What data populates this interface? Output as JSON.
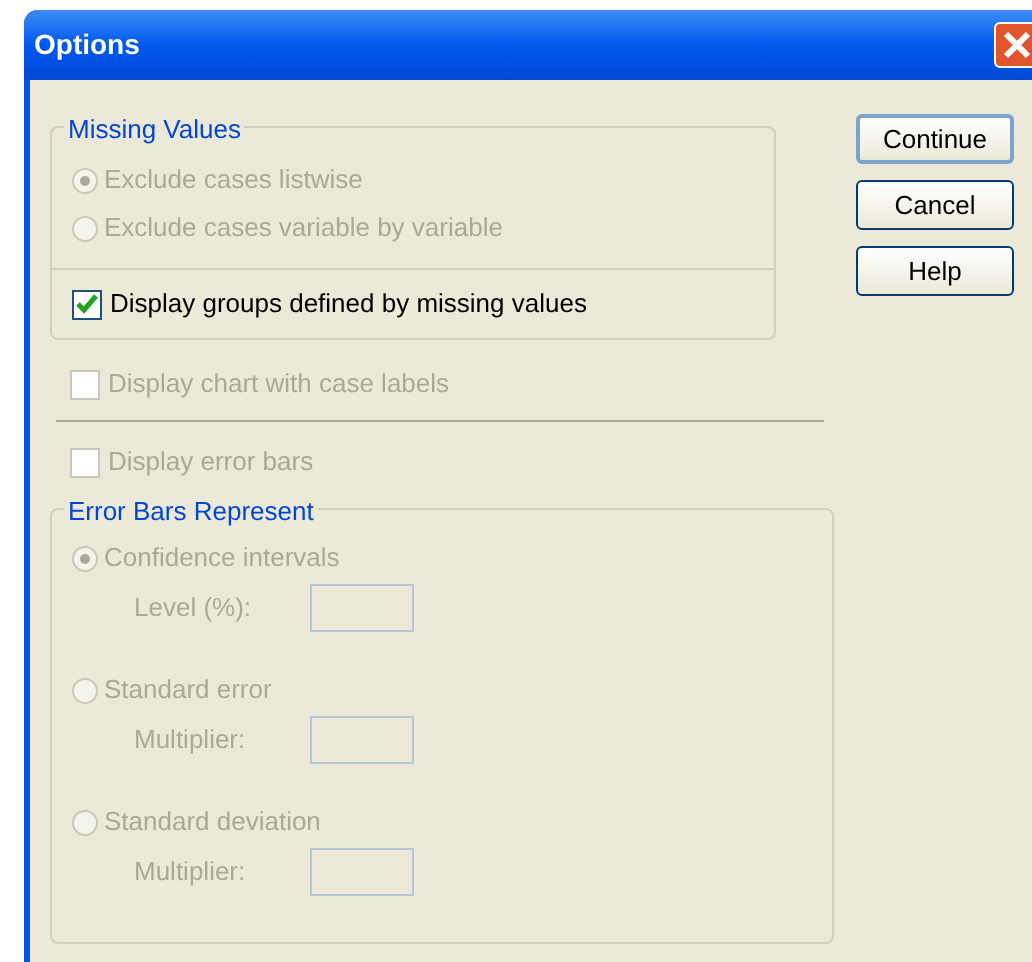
{
  "window": {
    "title": "Options"
  },
  "missing_values": {
    "legend": "Missing Values",
    "options": [
      {
        "label": "Exclude cases listwise",
        "selected": true,
        "disabled": true
      },
      {
        "label": "Exclude cases variable by variable",
        "selected": false,
        "disabled": true
      }
    ],
    "display_groups": {
      "label": "Display groups defined by missing values",
      "checked": true,
      "disabled": false
    }
  },
  "chart_case_labels": {
    "label": "Display chart with case labels",
    "checked": false,
    "disabled": true
  },
  "error_bars": {
    "label": "Display error bars",
    "checked": false,
    "disabled": true
  },
  "error_bars_represent": {
    "legend": "Error Bars Represent",
    "options": [
      {
        "label": "Confidence intervals",
        "selected": true,
        "disabled": true,
        "field_label": "Level (%):"
      },
      {
        "label": "Standard error",
        "selected": false,
        "disabled": true,
        "field_label": "Multiplier:"
      },
      {
        "label": "Standard deviation",
        "selected": false,
        "disabled": true,
        "field_label": "Multiplier:"
      }
    ]
  },
  "buttons": [
    {
      "label": "Continue",
      "default": true
    },
    {
      "label": "Cancel",
      "default": false
    },
    {
      "label": "Help",
      "default": false
    }
  ]
}
